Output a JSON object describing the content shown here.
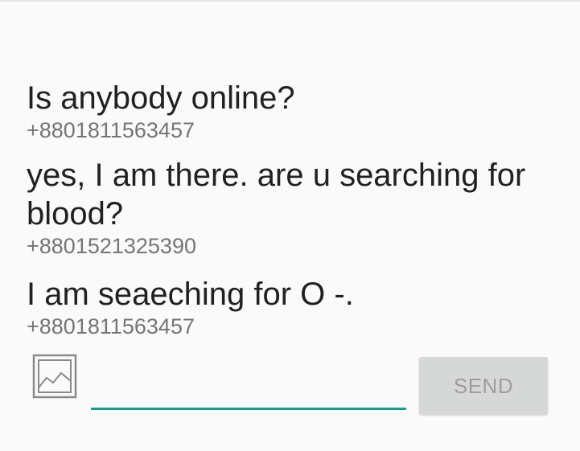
{
  "messages": [
    {
      "text": "Is anybody online?",
      "sender": "+8801811563457"
    },
    {
      "text": "yes, I am there. are u searching for blood?",
      "sender": "+8801521325390"
    },
    {
      "text": "I am seaeching for O -.",
      "sender": "+8801811563457"
    }
  ],
  "composer": {
    "input_value": "",
    "image_icon": "image-icon",
    "send_label": "SEND"
  },
  "colors": {
    "background": "#fafafa",
    "accent": "#139e8a",
    "send_button_bg": "#d6d7d7",
    "send_button_text": "#9e9e9e",
    "message_text": "#212121",
    "sender_text": "#757575"
  }
}
